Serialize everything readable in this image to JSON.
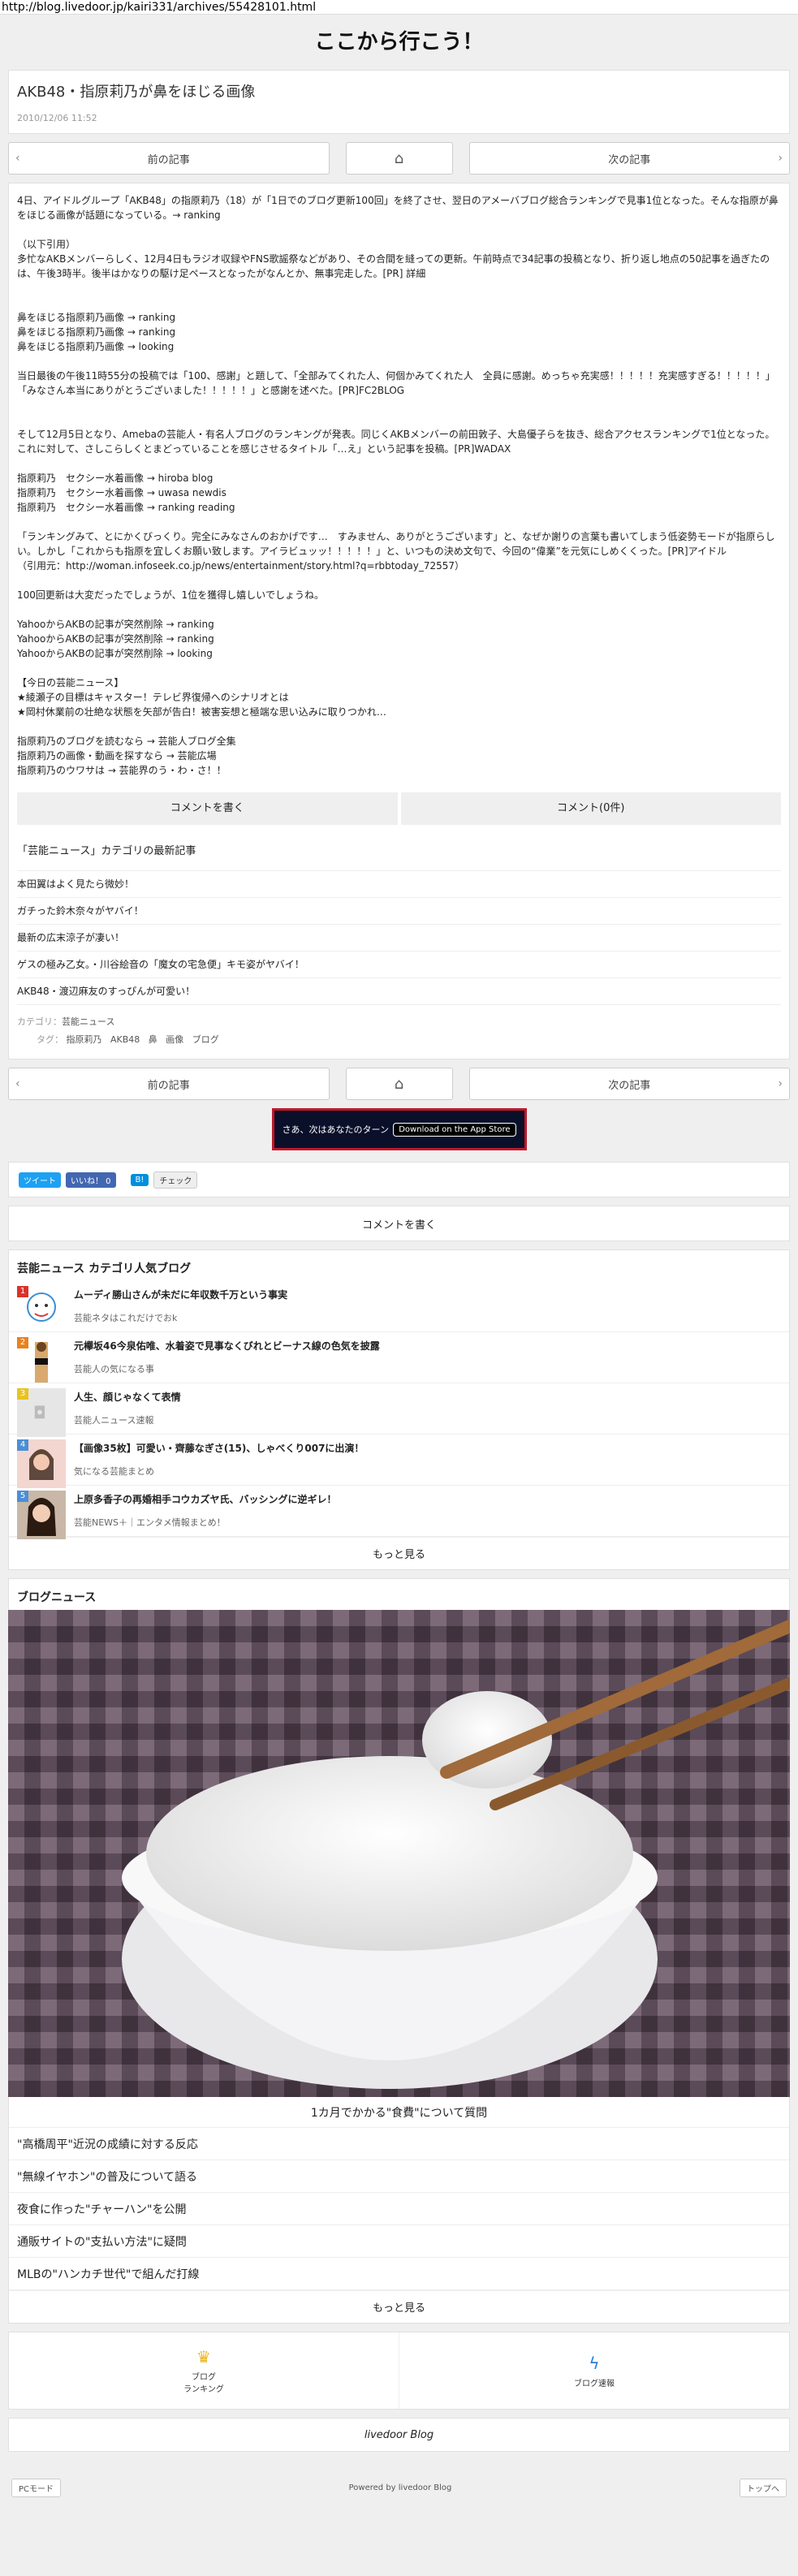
{
  "browser": {
    "url": "http://blog.livedoor.jp/kairi331/archives/55428101.html"
  },
  "blog": {
    "title": "ここから行こう！"
  },
  "article": {
    "title": "AKB48・指原莉乃が鼻をほじる画像",
    "date": "2010/12/06 11:52",
    "p1": "4日、アイドルグループ「AKB48」の指原莉乃（18）が「1日でのブログ更新100回」を終了させ、翌日のアメーバブログ総合ランキングで見事1位となった。そんな指原が鼻をほじる画像が話題になっている。→ ranking",
    "p2": "（以下引用）\n多忙なAKBメンバーらしく、12月4日もラジオ収録やFNS歌謡祭などがあり、その合間を縫っての更新。午前時点で34記事の投稿となり、折り返し地点の50記事を過ぎたのは、午後3時半。後半はかなりの駆け足ペースとなったがなんとか、無事完走した。[PR] 詳細",
    "p3": "鼻をほじる指原莉乃画像 → ranking\n鼻をほじる指原莉乃画像 → ranking\n鼻をほじる指原莉乃画像 → looking",
    "p4": "当日最後の午後11時55分の投稿では「100、感謝」と題して、「全部みてくれた人、何個かみてくれた人　全員に感謝。めっちゃ充実感！！！！！充実感すぎる！！！！！」「みなさん本当にありがとうございました！！！！！」と感謝を述べた。[PR]FC2BLOG",
    "p5": "そして12月5日となり、Amebaの芸能人・有名人ブログのランキングが発表。同じくAKBメンバーの前田敦子、大島優子らを抜き、総合アクセスランキングで1位となった。これに対して、さしこらしくとまどっていることを感じさせるタイトル「…え」という記事を投稿。[PR]WADAX",
    "p6": "指原莉乃　セクシー水着画像 → hiroba blog\n指原莉乃　セクシー水着画像 → uwasa newdis\n指原莉乃　セクシー水着画像 → ranking reading",
    "p7": "「ランキングみて、とにかくびっくり。完全にみなさんのおかげです…　すみません、ありがとうございます」と、なぜか謝りの言葉も書いてしまう低姿勢モードが指原らしい。しかし「これからも指原を宜しくお願い致します。アイラビュッッ！！！！！」と、いつもの決め文句で、今回の“偉業”を元気にしめくくった。[PR]アイドル\n（引用元：http://woman.infoseek.co.jp/news/entertainment/story.html?q=rbbtoday_72557）",
    "p8": "100回更新は大変だったでしょうが、1位を獲得し嬉しいでしょうね。",
    "p9": "YahooからAKBの記事が突然削除 → ranking\nYahooからAKBの記事が突然削除 → ranking\nYahooからAKBの記事が突然削除 → looking",
    "p10": "【今日の芸能ニュース】\n★綾瀬子の目標はキャスター！テレビ界復帰へのシナリオとは\n★岡村休業前の壮絶な状態を矢部が告白！被害妄想と極端な思い込みに取りつかれ…",
    "p11": "指原莉乃のブログを読むなら → 芸能人ブログ全集\n指原莉乃の画像・動画を探すなら → 芸能広場\n指原莉乃のウワサは → 芸能界のう・わ・さ！！"
  },
  "nav": {
    "prev": "前の記事",
    "next": "次の記事"
  },
  "comments": {
    "write": "コメントを書く",
    "count": "コメント(0件)"
  },
  "related": {
    "header": "「芸能ニュース」カテゴリの最新記事",
    "items": [
      "本田翼はよく見たら微妙！",
      "ガチった鈴木奈々がヤバイ！",
      "最新の広末涼子が凄い！",
      "ゲスの極み乙女。・川谷絵音の「魔女の宅急便」キモ姿がヤバイ！",
      "AKB48・渡辺麻友のすっぴんが可愛い！"
    ]
  },
  "meta": {
    "category_label": "カテゴリ：",
    "category": "芸能ニュース",
    "tag_label": "タグ：",
    "tags": [
      "指原莉乃",
      "AKB48",
      "鼻",
      "画像",
      "ブログ"
    ]
  },
  "ad": {
    "text": "さあ、次はあなたのターン",
    "store": "Download on the App Store"
  },
  "share": {
    "tweet": "ツイート",
    "like": "いいね！ 0",
    "hatena": "B!",
    "check": "チェック"
  },
  "comment_bar": "コメントを書く",
  "ranking": {
    "title": "芸能ニュース カテゴリ人気ブログ",
    "items": [
      {
        "rank": "1",
        "title": "ムーディ勝山さんが未だに年収数千万という事実",
        "sub": "芸能ネタはこれだけでおk"
      },
      {
        "rank": "2",
        "title": "元欅坂46今泉佑唯、水着姿で見事なくびれとビーナス線の色気を披露",
        "sub": "芸能人の気になる事"
      },
      {
        "rank": "3",
        "title": "人生、顔じゃなくて表情",
        "sub": "芸能人ニュース速報"
      },
      {
        "rank": "4",
        "title": "【画像35枚】可愛い・齊藤なぎさ(15)、しゃべくり007に出演！",
        "sub": "気になる芸能まとめ"
      },
      {
        "rank": "5",
        "title": "上原多香子の再婚相手コウカズヤ氏、バッシングに逆ギレ！",
        "sub": "芸能NEWS＋｜エンタメ情報まとめ！"
      }
    ],
    "more": "もっと見る"
  },
  "news": {
    "title": "ブログニュース",
    "caption": "1カ月でかかる\"食費\"について質問",
    "items": [
      "\"高橋周平\"近況の成績に対する反応",
      "\"無線イヤホン\"の普及について語る",
      "夜食に作った\"チャーハン\"を公開",
      "通販サイトの\"支払い方法\"に疑問",
      "MLBの\"ハンカチ世代\"で組んだ打線"
    ],
    "more": "もっと見る"
  },
  "bottomnav": {
    "ranking": "ブログ\nランキング",
    "news": "ブログ速報"
  },
  "footer": {
    "logo": "livedoor Blog",
    "pc": "PCモード",
    "powered": "Powered by livedoor Blog",
    "top": "トップへ"
  },
  "colors": {
    "rank1": "#d9332b",
    "rank2": "#e8821e",
    "rank3": "#e8c41e",
    "rank4": "#4a8fd6",
    "rank5": "#4a8fd6"
  }
}
